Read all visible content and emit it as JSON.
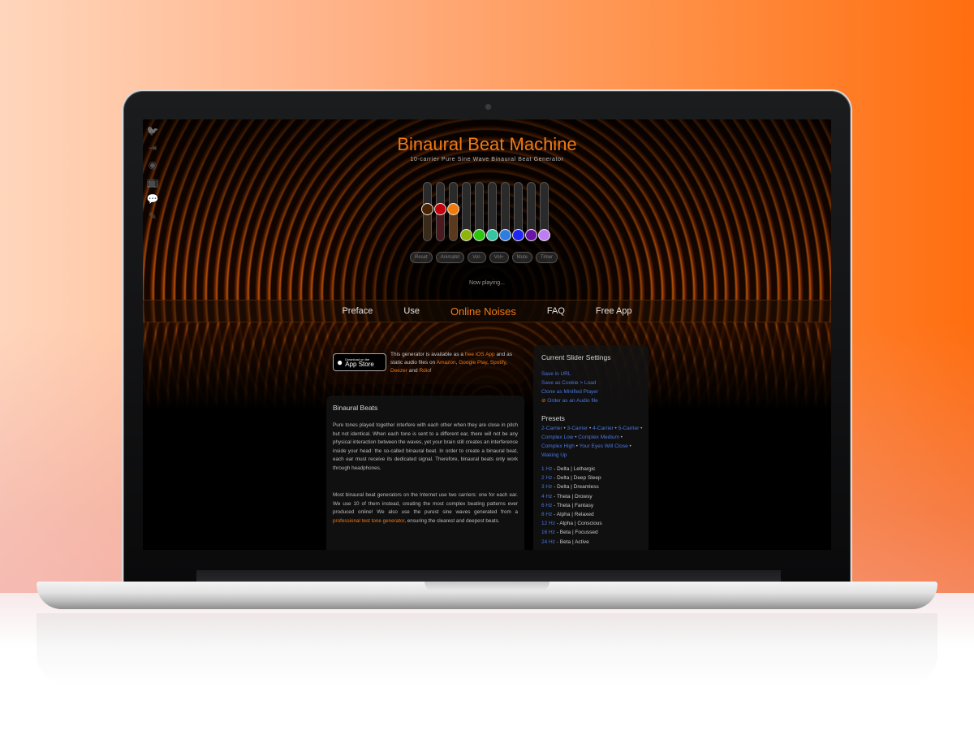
{
  "site": {
    "title": "Binaural Beat Machine",
    "subtitle": "10-carrier Pure Sine Wave Binaural Beat Generator",
    "now_playing": "Now playing..."
  },
  "sidebar_icons": [
    {
      "name": "twitter-facebook-icon",
      "glyph": "🐦",
      "active": false
    },
    {
      "name": "login-icon",
      "glyph": "⇥",
      "active": false
    },
    {
      "name": "record-player-icon",
      "glyph": "◉",
      "active": false
    },
    {
      "name": "tv-icon",
      "glyph": "📺",
      "active": false
    },
    {
      "name": "chat-heart-icon",
      "glyph": "💬",
      "active": true
    },
    {
      "name": "pencil-icon",
      "glyph": "✎",
      "active": false
    }
  ],
  "sliders": [
    {
      "color": "#4a2300",
      "fill": "#3a2a1a",
      "level": 0.55
    },
    {
      "color": "#c4000a",
      "fill": "#4a1a1e",
      "level": 0.55
    },
    {
      "color": "#f07a0a",
      "fill": "#5a3a1e",
      "level": 0.55
    },
    {
      "color": "#8db30c",
      "fill": "",
      "level": 0.0
    },
    {
      "color": "#2cc50e",
      "fill": "",
      "level": 0.0
    },
    {
      "color": "#33c6a0",
      "fill": "",
      "level": 0.0
    },
    {
      "color": "#2f7de0",
      "fill": "",
      "level": 0.0
    },
    {
      "color": "#1f25f5",
      "fill": "",
      "level": 0.0
    },
    {
      "color": "#6b15a8",
      "fill": "",
      "level": 0.0
    },
    {
      "color": "#c07cf5",
      "fill": "",
      "level": 0.0
    }
  ],
  "controls": [
    "Reset",
    "Animate!",
    "Vol-",
    "Vol+",
    "Mute",
    "Timer"
  ],
  "nav": [
    {
      "label": "Preface",
      "active": false
    },
    {
      "label": "Use",
      "active": false
    },
    {
      "label": "Online Noises",
      "active": true
    },
    {
      "label": "FAQ",
      "active": false
    },
    {
      "label": " Free App",
      "active": false
    }
  ],
  "promo": {
    "badge_small": "Download on the",
    "badge_big": "App Store",
    "text_1": "This generator is available as a ",
    "link_ios": "free iOS App",
    "text_2": " and as static audio files on ",
    "link_amazon": "Amazon",
    "link_google": "Google Play",
    "link_spotify": "Spotify",
    "link_deezer": "Deezer",
    "text_and": " and ",
    "link_rdio": "Rdio",
    "text_end": "!"
  },
  "article": {
    "heading": "Binaural Beats",
    "p1": "Pure tones played together interfere with each other when they are close in pitch but not identical. When each tone is sent to a different ear, there will not be any physical interaction between the waves, yet your brain still creates an interference inside your head: the so-called binaural beat. In order to create a binaural beat, each ear must receive its dedicated signal. Therefore, binaural beats only work through headphones.",
    "p2_a": "Most binaural beat generators on the Internet use two carriers: one for each ear. We use 10 of them instead, creating the most complex beating patterns ever produced online! We also use the purest sine waves generated from a ",
    "p2_link": "professional test tone generator",
    "p2_b": ", ensuring the clearest and deepest beats."
  },
  "settings": {
    "heading": "Current Slider Settings",
    "links": [
      "Save in URL",
      "Save as Cookie > Load",
      "Clone as Minified Player",
      "⊘ Order as an Audio file"
    ],
    "presets_heading": "Presets",
    "presets": [
      "2-Carrier",
      "3-Carrier",
      "4-Carrier",
      "5-Carrier",
      "Complex Low",
      "Complex Medium",
      "Complex High",
      "Your Eyes Will Close",
      "Waking Up"
    ],
    "frequencies": [
      {
        "hz": "1 Hz",
        "desc": " - Delta | Lethargic"
      },
      {
        "hz": "2 Hz",
        "desc": " - Delta | Deep Sleep"
      },
      {
        "hz": "3 Hz",
        "desc": " - Delta | Dreamless"
      },
      {
        "hz": "4 Hz",
        "desc": " - Theta | Drowsy"
      },
      {
        "hz": "6 Hz",
        "desc": " - Theta | Fantasy"
      },
      {
        "hz": "8 Hz",
        "desc": " - Alpha | Relaxed"
      },
      {
        "hz": "12 Hz",
        "desc": " - Alpha | Conscious"
      },
      {
        "hz": "16 Hz",
        "desc": " - Beta | Focussed"
      },
      {
        "hz": "24 Hz",
        "desc": " - Beta | Active"
      }
    ]
  }
}
